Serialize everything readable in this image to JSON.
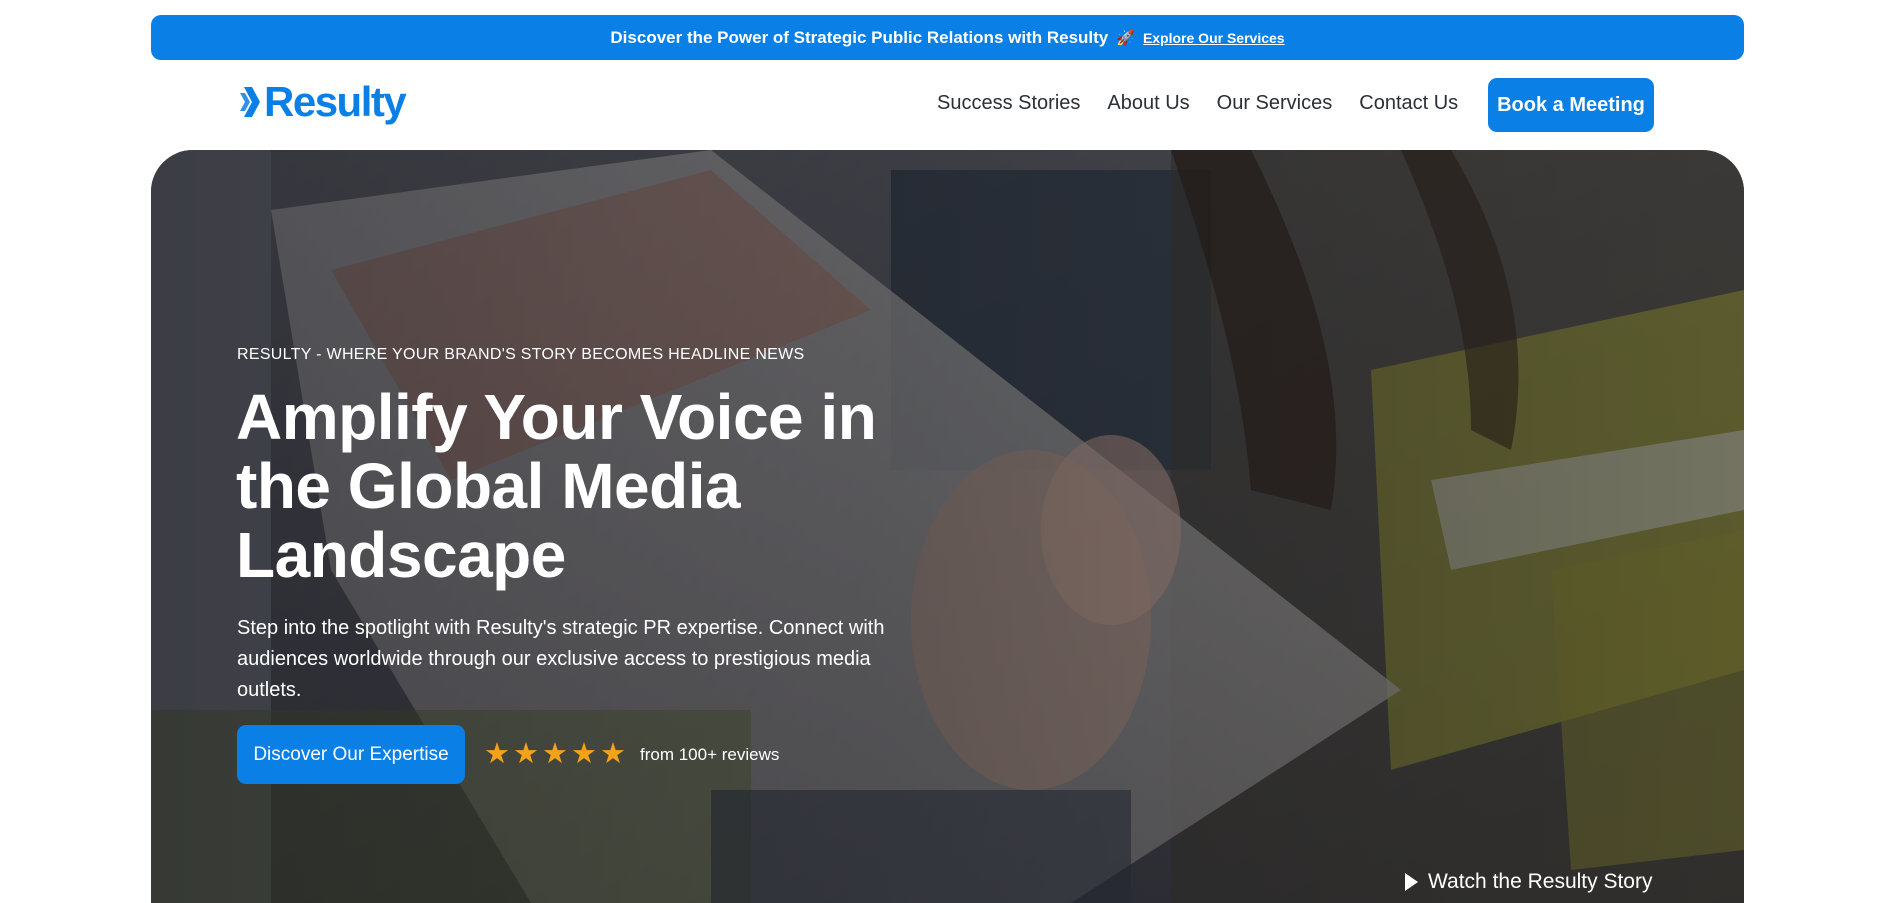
{
  "announcement": {
    "text": "Discover the Power of Strategic Public Relations with Resulty",
    "icon": "rocket-icon",
    "link_label": "Explore Our Services"
  },
  "header": {
    "logo_text": "Resulty",
    "nav": [
      {
        "label": "Success Stories"
      },
      {
        "label": "About Us"
      },
      {
        "label": "Our Services"
      },
      {
        "label": "Contact Us"
      }
    ],
    "cta_label": "Book a Meeting"
  },
  "hero": {
    "eyebrow": "RESULTY - WHERE YOUR BRAND'S STORY BECOMES HEADLINE NEWS",
    "headline": "Amplify Your Voice in the Global Media Landscape",
    "subtext": "Step into the spotlight with Resulty's strategic PR expertise. Connect with audiences worldwide through our exclusive access to prestigious media outlets.",
    "cta_label": "Discover Our Expertise",
    "rating": {
      "stars": 5,
      "reviews_text": "from 100+ reviews"
    },
    "watch_label": "Watch the Resulty Story"
  },
  "colors": {
    "brand_blue": "#0a7fe6",
    "star_orange": "#f5a21b",
    "text_dark": "#2b2f36"
  }
}
